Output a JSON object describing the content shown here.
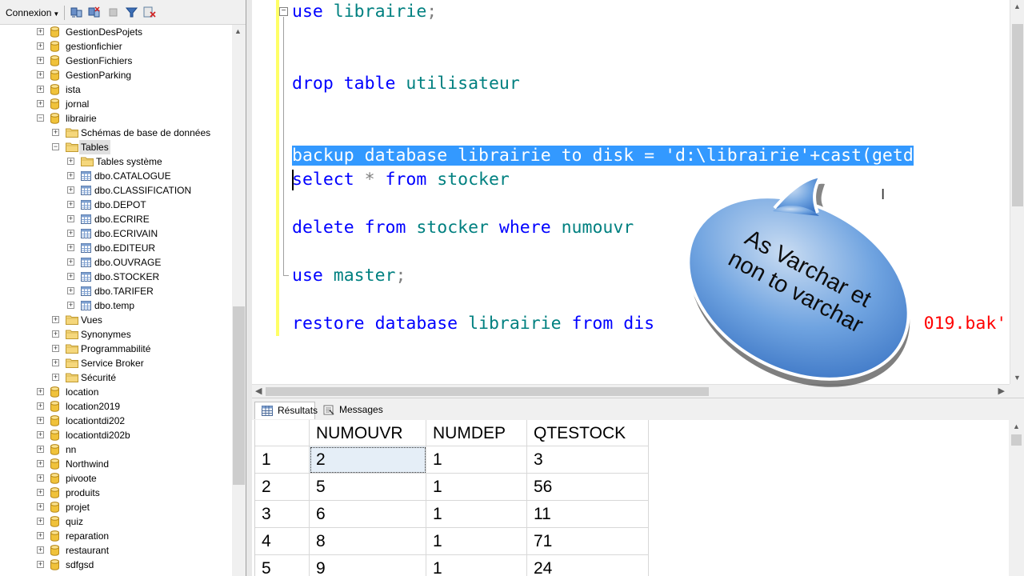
{
  "toolbar": {
    "connexion_label": "Connexion"
  },
  "explorer": {
    "nodes": [
      {
        "label": "GestionDesPojets",
        "type": "database"
      },
      {
        "label": "gestionfichier",
        "type": "database"
      },
      {
        "label": "GestionFichiers",
        "type": "database"
      },
      {
        "label": "GestionParking",
        "type": "database"
      },
      {
        "label": "ista",
        "type": "database"
      },
      {
        "label": "jornal",
        "type": "database"
      },
      {
        "label": "librairie",
        "type": "database",
        "expanded": true
      },
      {
        "label": "Schémas de base de données",
        "type": "folder"
      },
      {
        "label": "Tables",
        "type": "folder",
        "expanded": true,
        "selected": true
      },
      {
        "label": "Tables système",
        "type": "folder"
      },
      {
        "label": "dbo.CATALOGUE",
        "type": "table"
      },
      {
        "label": "dbo.CLASSIFICATION",
        "type": "table"
      },
      {
        "label": "dbo.DEPOT",
        "type": "table"
      },
      {
        "label": "dbo.ECRIRE",
        "type": "table"
      },
      {
        "label": "dbo.ECRIVAIN",
        "type": "table"
      },
      {
        "label": "dbo.EDITEUR",
        "type": "table"
      },
      {
        "label": "dbo.OUVRAGE",
        "type": "table"
      },
      {
        "label": "dbo.STOCKER",
        "type": "table"
      },
      {
        "label": "dbo.TARIFER",
        "type": "table"
      },
      {
        "label": "dbo.temp",
        "type": "table"
      },
      {
        "label": "Vues",
        "type": "folder"
      },
      {
        "label": "Synonymes",
        "type": "folder"
      },
      {
        "label": "Programmabilité",
        "type": "folder"
      },
      {
        "label": "Service Broker",
        "type": "folder"
      },
      {
        "label": "Sécurité",
        "type": "folder"
      },
      {
        "label": "location",
        "type": "database"
      },
      {
        "label": "location2019",
        "type": "database"
      },
      {
        "label": "locationtdi202",
        "type": "database"
      },
      {
        "label": "locationtdi202b",
        "type": "database"
      },
      {
        "label": "nn",
        "type": "database"
      },
      {
        "label": "Northwind",
        "type": "database"
      },
      {
        "label": "pivoote",
        "type": "database"
      },
      {
        "label": "produits",
        "type": "database"
      },
      {
        "label": "projet",
        "type": "database"
      },
      {
        "label": "quiz",
        "type": "database"
      },
      {
        "label": "reparation",
        "type": "database"
      },
      {
        "label": "restaurant",
        "type": "database"
      },
      {
        "label": "sdfgsd",
        "type": "database"
      }
    ]
  },
  "editor": {
    "lines": [
      {
        "tokens": [
          {
            "t": "use",
            "c": "kw"
          },
          {
            "t": " "
          },
          {
            "t": "librairie",
            "c": "id"
          },
          {
            "t": ";",
            "c": "op"
          }
        ]
      },
      {
        "tokens": [
          {
            "t": "drop",
            "c": "kw"
          },
          {
            "t": " "
          },
          {
            "t": "table",
            "c": "kw"
          },
          {
            "t": " "
          },
          {
            "t": "utilisateur",
            "c": "id"
          }
        ]
      },
      {
        "highlight": true,
        "tokens": [
          {
            "t": "backup",
            "c": "kw"
          },
          {
            "t": " "
          },
          {
            "t": "database",
            "c": "kw"
          },
          {
            "t": " "
          },
          {
            "t": "librairie",
            "c": "id"
          },
          {
            "t": " "
          },
          {
            "t": "to",
            "c": "kw"
          },
          {
            "t": " "
          },
          {
            "t": "disk",
            "c": "kw"
          },
          {
            "t": " "
          },
          {
            "t": "=",
            "c": "op"
          },
          {
            "t": " "
          },
          {
            "t": "'d:\\librairie'",
            "c": "str"
          },
          {
            "t": "+",
            "c": "op"
          },
          {
            "t": "cast",
            "c": "kw"
          },
          {
            "t": "(",
            "c": "op"
          },
          {
            "t": "getd",
            "c": "kw"
          }
        ]
      },
      {
        "tokens": [
          {
            "t": "select",
            "c": "kw"
          },
          {
            "t": " "
          },
          {
            "t": "*",
            "c": "op"
          },
          {
            "t": " "
          },
          {
            "t": "from",
            "c": "kw"
          },
          {
            "t": " "
          },
          {
            "t": "stocker",
            "c": "id"
          }
        ]
      },
      {
        "tokens": [
          {
            "t": "delete",
            "c": "kw"
          },
          {
            "t": " "
          },
          {
            "t": "from",
            "c": "kw"
          },
          {
            "t": " "
          },
          {
            "t": "stocker",
            "c": "id"
          },
          {
            "t": " "
          },
          {
            "t": "where",
            "c": "kw"
          },
          {
            "t": " "
          },
          {
            "t": "numouvr",
            "c": "id"
          }
        ]
      },
      {
        "tokens": [
          {
            "t": "use",
            "c": "kw"
          },
          {
            "t": " "
          },
          {
            "t": "master",
            "c": "id"
          },
          {
            "t": ";",
            "c": "op"
          }
        ]
      },
      {
        "tokens": [
          {
            "t": "restore",
            "c": "kw"
          },
          {
            "t": " "
          },
          {
            "t": "database",
            "c": "kw"
          },
          {
            "t": " "
          },
          {
            "t": "librairie",
            "c": "id"
          },
          {
            "t": " "
          },
          {
            "t": "from",
            "c": "kw"
          },
          {
            "t": " "
          },
          {
            "t": "dis",
            "c": "kw"
          },
          {
            "t": "                          "
          },
          {
            "t": "019.bak'",
            "c": "str"
          }
        ]
      }
    ]
  },
  "results": {
    "tab_results": "Résultats",
    "tab_messages": "Messages",
    "columns": [
      "NUMOUVR",
      "NUMDEP",
      "QTESTOCK"
    ],
    "rows": [
      {
        "n": "1",
        "cells": [
          "2",
          "1",
          "3"
        ]
      },
      {
        "n": "2",
        "cells": [
          "5",
          "1",
          "56"
        ]
      },
      {
        "n": "3",
        "cells": [
          "6",
          "1",
          "11"
        ]
      },
      {
        "n": "4",
        "cells": [
          "8",
          "1",
          "71"
        ]
      },
      {
        "n": "5",
        "cells": [
          "9",
          "1",
          "24"
        ]
      }
    ]
  },
  "callout": {
    "line1": "As Varchar et",
    "line2": "non to varchar"
  },
  "colors": {
    "keyword": "#0000ff",
    "identifier": "#008080",
    "string": "#ff0000",
    "operator": "#808080",
    "selection": "#3399ff",
    "change_bar": "#ffff66",
    "bubble": "#4a8fd6"
  }
}
